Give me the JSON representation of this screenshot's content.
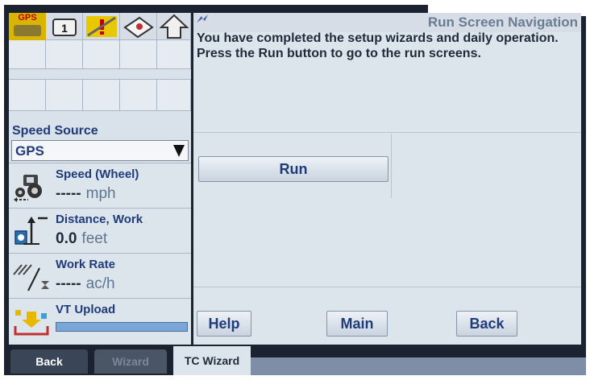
{
  "status_icons": {
    "gps_label": "GPS",
    "unit_number": "1"
  },
  "speed_source": {
    "label": "Speed Source",
    "selected": "GPS"
  },
  "metrics": [
    {
      "label": "Speed (Wheel)",
      "value": "-----",
      "unit": "mph",
      "icon": "tractor-icon"
    },
    {
      "label": "Distance, Work",
      "value": "0.0",
      "unit": "feet",
      "icon": "distance-icon"
    },
    {
      "label": "Work Rate",
      "value": "-----",
      "unit": "ac/h",
      "icon": "work-rate-icon"
    }
  ],
  "vt_upload": {
    "label": "VT Upload",
    "progress_fraction": 1.0,
    "icon": "upload-icon"
  },
  "panel": {
    "title": "Run Screen Navigation",
    "message": "You have completed the setup wizards and daily operation. Press the Run button to go to the run screens.",
    "run_label": "Run",
    "help_label": "Help",
    "main_label": "Main",
    "back_label": "Back"
  },
  "tabs": {
    "back": "Back",
    "wizard": "Wizard",
    "tc_wizard": "TC Wizard"
  },
  "colors": {
    "frame": "#1b2331",
    "panel": "#dde5ec",
    "label_blue": "#1f3b7a",
    "gps_yellow": "#d9b400"
  }
}
